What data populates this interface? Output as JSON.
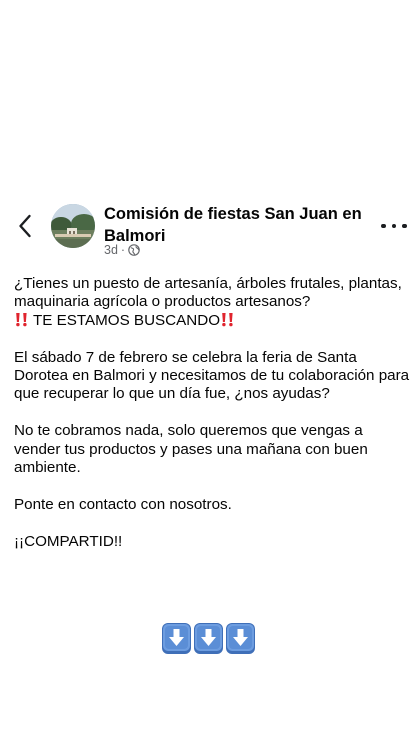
{
  "post": {
    "author": "Comisión de fiestas San Juan en Balmori",
    "time": "3d",
    "separator": "·",
    "privacy_icon": "globe-icon",
    "paragraph_1": "¿Tienes un puesto de artesanía, árboles frutales, plantas, maquinaria agrícola o productos artesanos?",
    "highlight": "TE ESTAMOS BUSCANDO",
    "paragraph_2": "El sábado 7 de febrero se celebra la feria de Santa Dorotea en Balmori y necesitamos de tu colaboración para que recuperar lo que un día fue, ¿nos ayudas?",
    "paragraph_3": "No te cobramos nada, solo queremos que vengas a vender tus productos y pases una mañana con buen ambiente.",
    "paragraph_4": "Ponte en contacto con nosotros.",
    "paragraph_5": "¡¡COMPARTID!!",
    "emoji_arrows": [
      "down-arrow-emoji",
      "down-arrow-emoji",
      "down-arrow-emoji"
    ]
  },
  "icons": {
    "back": "chevron-left-icon",
    "more": "more-options-icon",
    "emphasis": "double-exclamation-emoji"
  },
  "colors": {
    "text": "#050505",
    "meta": "#65676b",
    "exclamation": "#e0242e",
    "arrow_key": "#5b8ed6"
  }
}
